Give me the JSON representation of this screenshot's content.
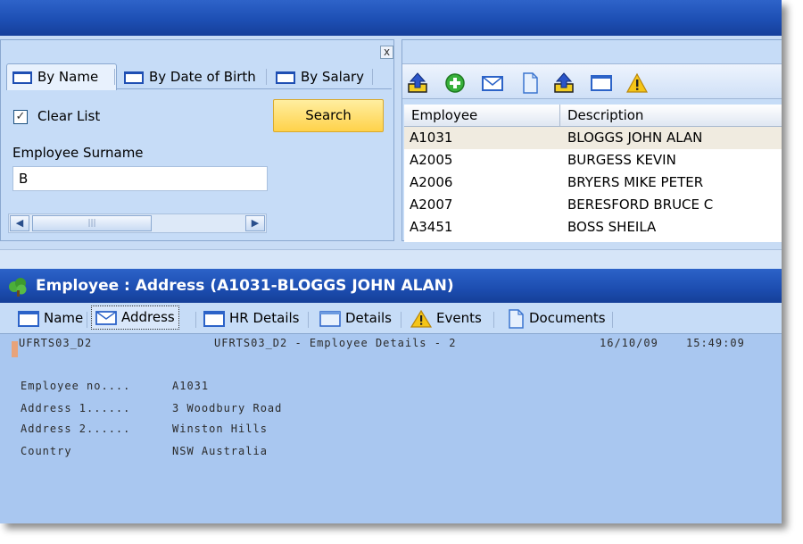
{
  "search_panel": {
    "close_glyph": "x",
    "tabs": [
      {
        "label": "By Name",
        "active": true
      },
      {
        "label": "By Date of Birth",
        "active": false
      },
      {
        "label": "By Salary",
        "active": false
      }
    ],
    "clear_list_label": "Clear List",
    "clear_list_checked": true,
    "search_button": "Search",
    "surname_label": "Employee Surname",
    "surname_value": "B"
  },
  "results_panel": {
    "toolbar_icons": [
      "upload-arrow-icon",
      "add-circle-icon",
      "envelope-icon",
      "document-icon",
      "upload-arrow-icon",
      "window-icon",
      "warning-icon"
    ],
    "columns": [
      "Employee",
      "Description"
    ],
    "rows": [
      {
        "employee": "A1031",
        "description": "BLOGGS JOHN ALAN",
        "selected": true
      },
      {
        "employee": "A2005",
        "description": "BURGESS KEVIN",
        "selected": false
      },
      {
        "employee": "A2006",
        "description": "BRYERS MIKE PETER",
        "selected": false
      },
      {
        "employee": "A2007",
        "description": "BERESFORD BRUCE C",
        "selected": false
      },
      {
        "employee": "A3451",
        "description": "BOSS SHEILA",
        "selected": false
      }
    ]
  },
  "detail": {
    "title": "Employee : Address (A1031-BLOGGS JOHN ALAN)",
    "tabs": [
      {
        "label": "Name",
        "icon": "window-icon",
        "active": false
      },
      {
        "label": "Address",
        "icon": "envelope-icon",
        "active": true
      },
      {
        "label": "HR Details",
        "icon": "window-icon",
        "active": false
      },
      {
        "label": "Details",
        "icon": "window-icon",
        "active": false
      },
      {
        "label": "Events",
        "icon": "warning-icon",
        "active": false
      },
      {
        "label": "Documents",
        "icon": "document-icon",
        "active": false
      }
    ],
    "terminal": {
      "program": "UFRTS03_D2",
      "heading": "UFRTS03_D2 - Employee Details - 2",
      "date": "16/10/09",
      "time": "15:49:09",
      "fields": [
        {
          "label": "Employee no....",
          "value": "A1031"
        },
        {
          "label": "Address 1......",
          "value": "3 Woodbury Road"
        },
        {
          "label": "Address 2......",
          "value": "Winston Hills"
        },
        {
          "label": "Country",
          "value": "NSW Australia"
        }
      ]
    }
  },
  "colors": {
    "title_bar": "#1d4fb4",
    "panel_bg": "#c6dcf7",
    "search_button": "#ffd24a",
    "terminal_bg": "#a9c7f0",
    "selected_row": "#f0ebe0"
  }
}
